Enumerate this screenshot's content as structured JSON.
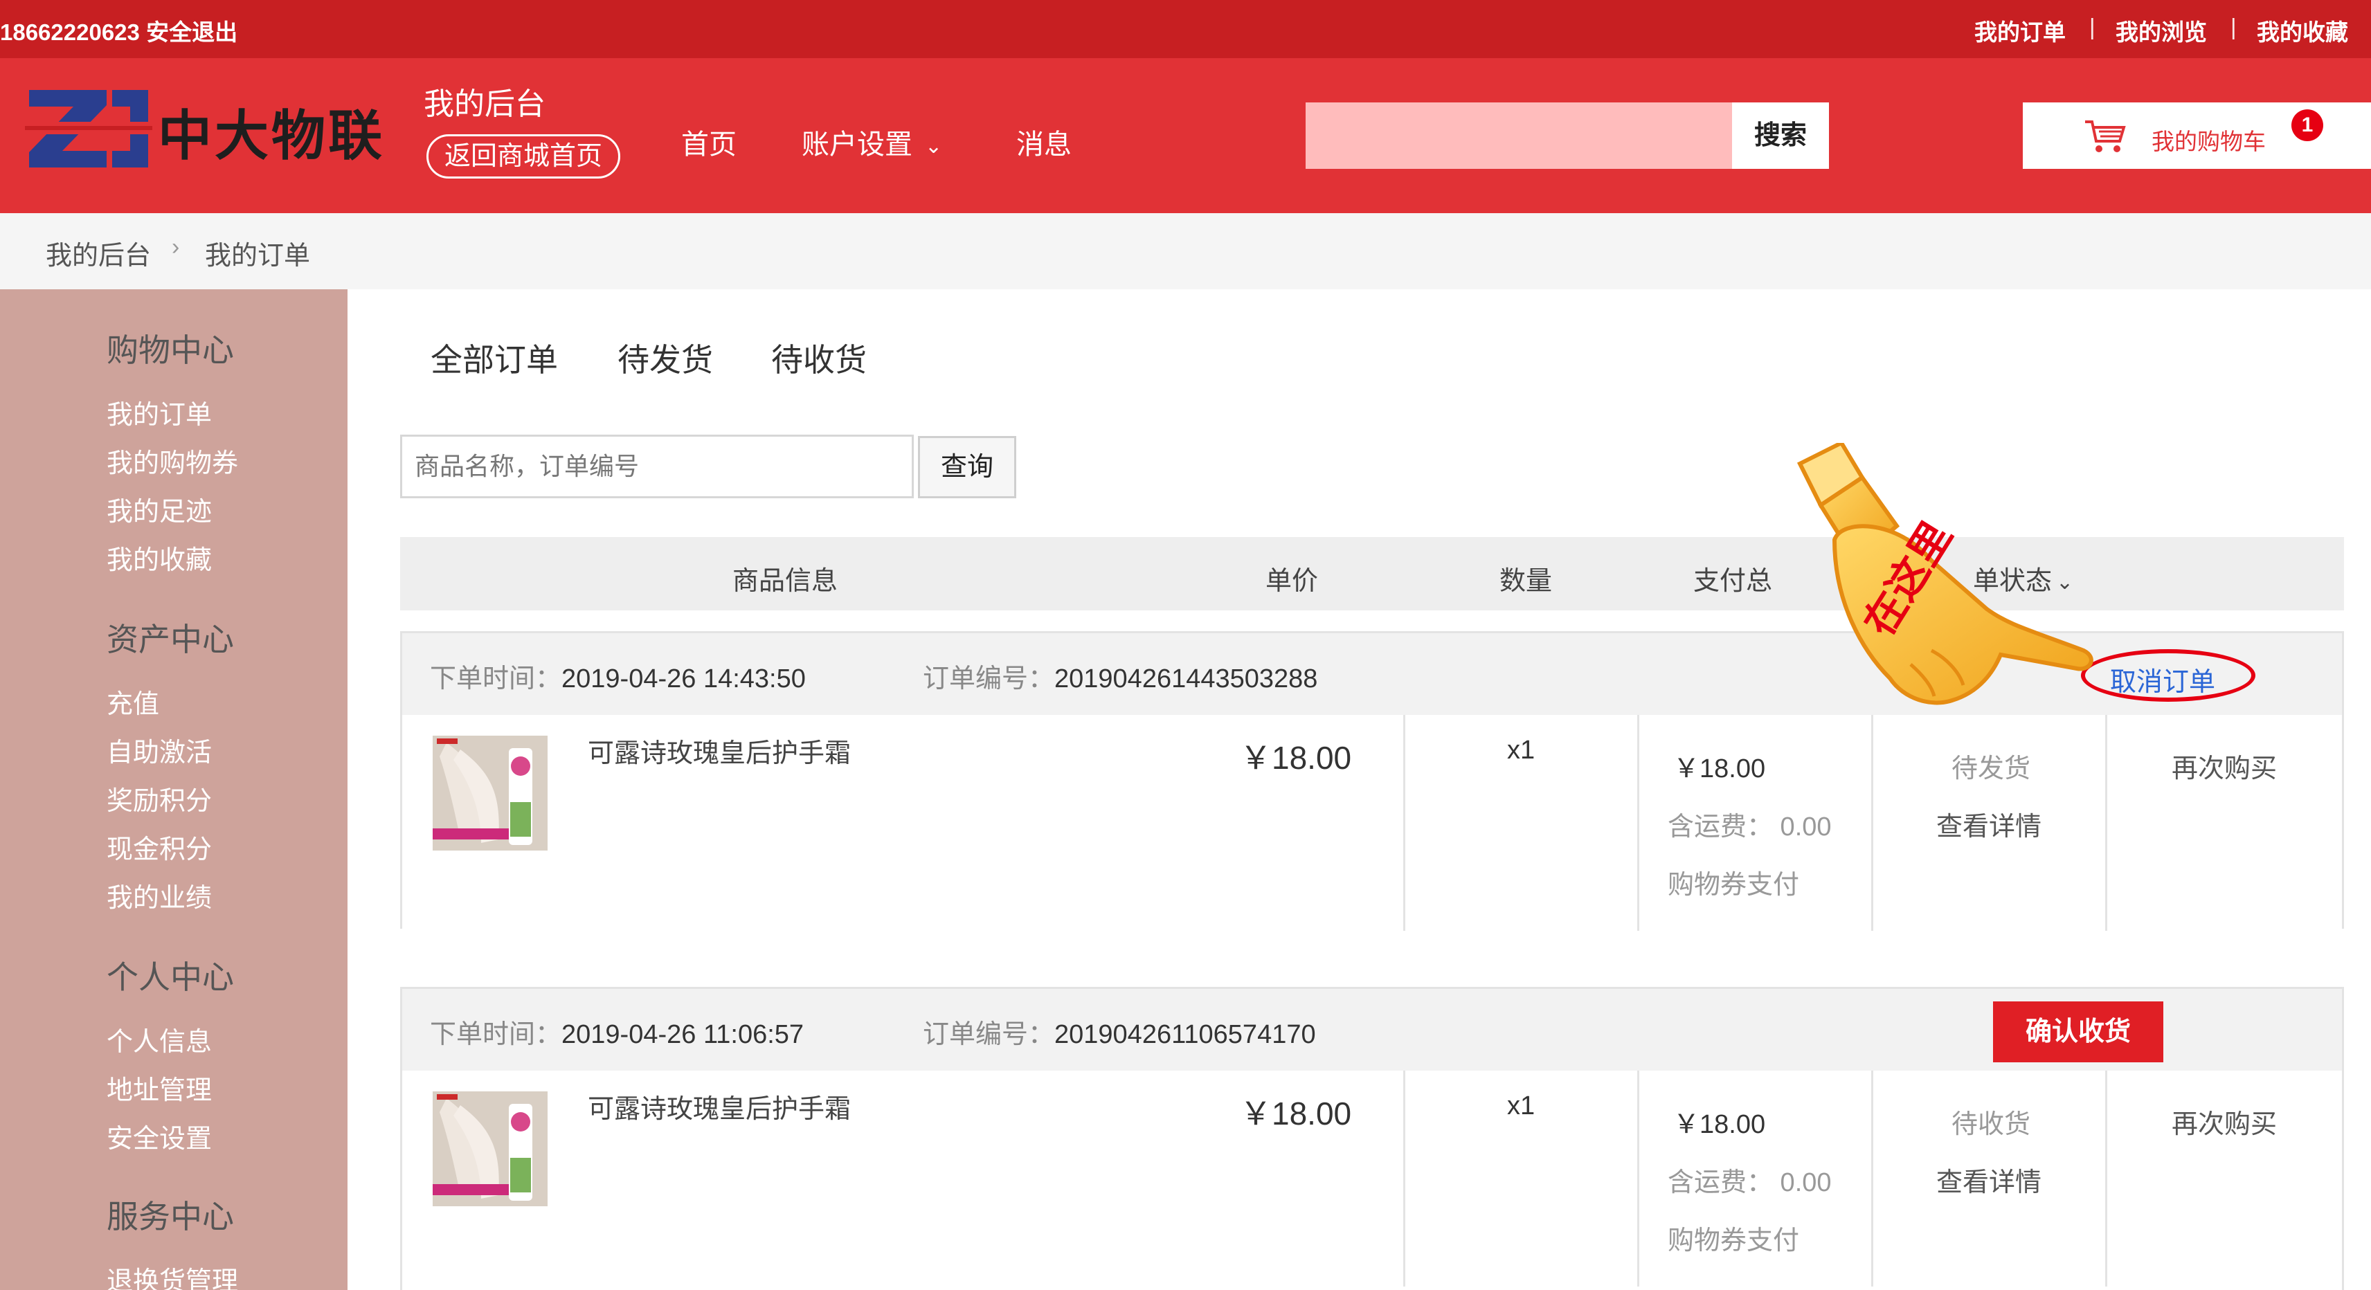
{
  "topbar": {
    "user_phone": "18662220623",
    "logout": "安全退出",
    "links": [
      "我的订单",
      "我的浏览",
      "我的收藏"
    ],
    "separator": "|"
  },
  "header": {
    "logo_text": "中大物联",
    "backend_title": "我的后台",
    "back_to_mall": "返回商城首页",
    "nav": [
      "首页",
      "账户设置",
      "消息"
    ],
    "search_button": "搜索",
    "search_placeholder": "",
    "cart_label": "我的购物车",
    "cart_count": "1"
  },
  "breadcrumb": [
    "我的后台",
    "我的订单"
  ],
  "sidebar": {
    "sections": [
      {
        "title": "购物中心",
        "items": [
          "我的订单",
          "我的购物券",
          "我的足迹",
          "我的收藏"
        ]
      },
      {
        "title": "资产中心",
        "items": [
          "充值",
          "自助激活",
          "奖励积分",
          "现金积分",
          "我的业绩"
        ]
      },
      {
        "title": "个人中心",
        "items": [
          "个人信息",
          "地址管理",
          "安全设置"
        ]
      },
      {
        "title": "服务中心",
        "items": [
          "退换货管理"
        ]
      }
    ]
  },
  "tabs": [
    "全部订单",
    "待发货",
    "待收货"
  ],
  "query": {
    "placeholder": "商品名称，订单编号",
    "button": "查询"
  },
  "table_headers": [
    "商品信息",
    "单价",
    "数量",
    "支付总",
    "单状态"
  ],
  "annotation": {
    "pointer_label": "在这里"
  },
  "orders": [
    {
      "time_label": "下单时间：",
      "time": "2019-04-26 14:43:50",
      "no_label": "订单编号：",
      "no": "201904261443503288",
      "action": "取消订单",
      "product": "可露诗玫瑰皇后护手霜",
      "price": "￥18.00",
      "qty": "x1",
      "total": "￥18.00",
      "shipping": "含运费： 0.00",
      "pay_method": "购物券支付",
      "status": "待发货",
      "detail": "查看详情",
      "rebuy": "再次购买"
    },
    {
      "time_label": "下单时间：",
      "time": "2019-04-26 11:06:57",
      "no_label": "订单编号：",
      "no": "201904261106574170",
      "action": "确认收货",
      "product": "可露诗玫瑰皇后护手霜",
      "price": "￥18.00",
      "qty": "x1",
      "total": "￥18.00",
      "shipping": "含运费： 0.00",
      "pay_method": "购物券支付",
      "status": "待收货",
      "detail": "查看详情",
      "rebuy": "再次购买"
    }
  ],
  "colors": {
    "topbar": "#c71f22",
    "header": "#e13236",
    "sidebar": "#cea39b",
    "confirm": "#e01f25",
    "link": "#2b66d6"
  }
}
